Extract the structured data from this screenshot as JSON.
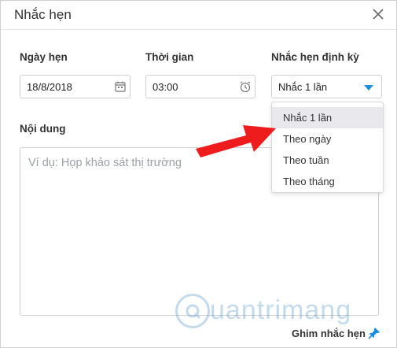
{
  "dialog": {
    "title": "Nhắc hẹn",
    "close_icon": "close-icon"
  },
  "form": {
    "date": {
      "label": "Ngày hẹn",
      "value": "18/8/2018",
      "icon": "calendar-icon"
    },
    "time": {
      "label": "Thời gian",
      "value": "03:00",
      "icon": "alarm-clock-icon"
    },
    "repeat": {
      "label": "Nhắc hẹn định kỳ",
      "value": "Nhắc 1 lần",
      "caret_color": "#1a8fe0",
      "options": [
        "Nhắc 1 lần",
        "Theo ngày",
        "Theo tuần",
        "Theo tháng"
      ],
      "selected_index": 0
    },
    "content": {
      "label": "Nội dung",
      "placeholder": "Ví dụ: Họp khảo sát thị trường"
    }
  },
  "footer": {
    "pin_label": "Ghim nhắc hẹn",
    "pin_icon": "pin-icon",
    "pin_color": "#1a8fe0"
  },
  "overlay": {
    "arrow_color": "#ee1c1c"
  },
  "watermark": {
    "text": "uantrimang"
  }
}
